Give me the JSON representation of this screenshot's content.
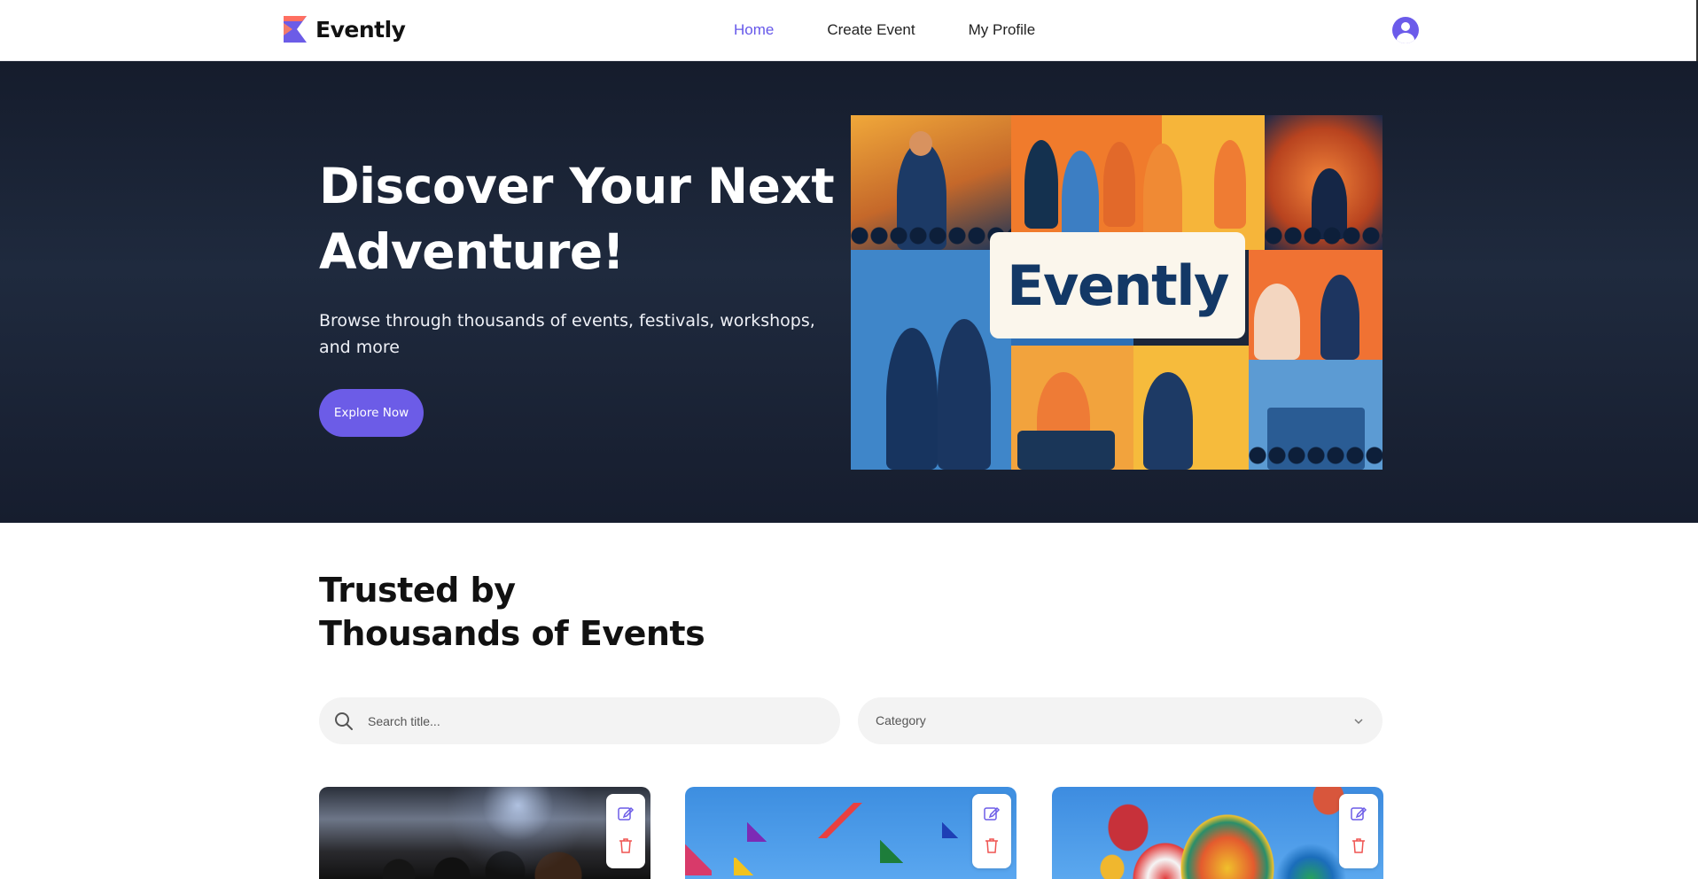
{
  "header": {
    "brand": "Evently",
    "nav": [
      {
        "label": "Home",
        "active": true
      },
      {
        "label": "Create Event",
        "active": false
      },
      {
        "label": "My Profile",
        "active": false
      }
    ],
    "accent_color": "#6c5ce7"
  },
  "hero": {
    "title": "Discover Your Next Adventure!",
    "subtitle": "Browse through thousands of events, festivals, workshops, and more",
    "cta_label": "Explore Now",
    "image_logo_text": "Evently"
  },
  "events_section": {
    "title_line1": "Trusted by",
    "title_line2": "Thousands of Events",
    "search": {
      "placeholder": "Search title...",
      "value": ""
    },
    "category": {
      "selected": "Category"
    },
    "cards": [
      {
        "image": "concert-stage-crowd",
        "actions": [
          "edit-icon",
          "delete-icon"
        ]
      },
      {
        "image": "kites-in-blue-sky",
        "actions": [
          "edit-icon",
          "delete-icon"
        ]
      },
      {
        "image": "hot-air-balloons",
        "actions": [
          "edit-icon",
          "delete-icon"
        ]
      }
    ]
  }
}
